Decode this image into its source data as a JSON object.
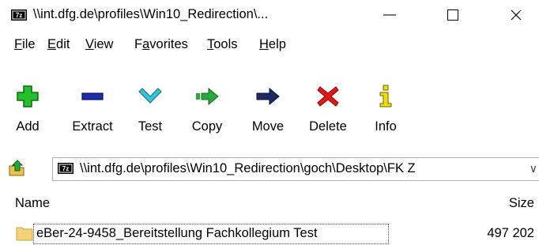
{
  "window": {
    "title": "\\\\int.dfg.de\\profiles\\Win10_Redirection\\...",
    "minimize_glyph": "—",
    "maximize_glyph": "☐",
    "close_glyph": "✕",
    "app_icon": "7z-icon"
  },
  "menu": {
    "items": [
      {
        "key": "F",
        "rest": "ile"
      },
      {
        "key": "E",
        "rest": "dit"
      },
      {
        "key": "V",
        "rest": "iew"
      },
      {
        "pre": "F",
        "key": "a",
        "rest": "vorites"
      },
      {
        "key": "T",
        "rest": "ools"
      },
      {
        "key": "H",
        "rest": "elp"
      }
    ]
  },
  "toolbar": {
    "add": {
      "label": "Add",
      "icon": "plus-icon",
      "color": "#22c02a"
    },
    "extract": {
      "label": "Extract",
      "icon": "minus-icon",
      "color": "#1c2ba6"
    },
    "test": {
      "label": "Test",
      "icon": "check-icon",
      "color": "#38c4d6"
    },
    "copy": {
      "label": "Copy",
      "icon": "arrow-right-icon",
      "color": "#2aa83a"
    },
    "move": {
      "label": "Move",
      "icon": "arrow-right-icon",
      "color": "#1c2a66"
    },
    "delete": {
      "label": "Delete",
      "icon": "x-icon",
      "color": "#e01818"
    },
    "info": {
      "label": "Info",
      "icon": "info-icon",
      "color": "#c8b400"
    }
  },
  "address": {
    "path": "\\\\int.dfg.de\\profiles\\Win10_Redirection\\goch\\Desktop\\FK Z",
    "dropdown_glyph": "∨"
  },
  "list": {
    "columns": {
      "name": "Name",
      "size": "Size"
    },
    "rows": [
      {
        "name": "eBer-24-9458_Bereitstellung Fachkollegium Test",
        "size": "497 202"
      }
    ]
  }
}
